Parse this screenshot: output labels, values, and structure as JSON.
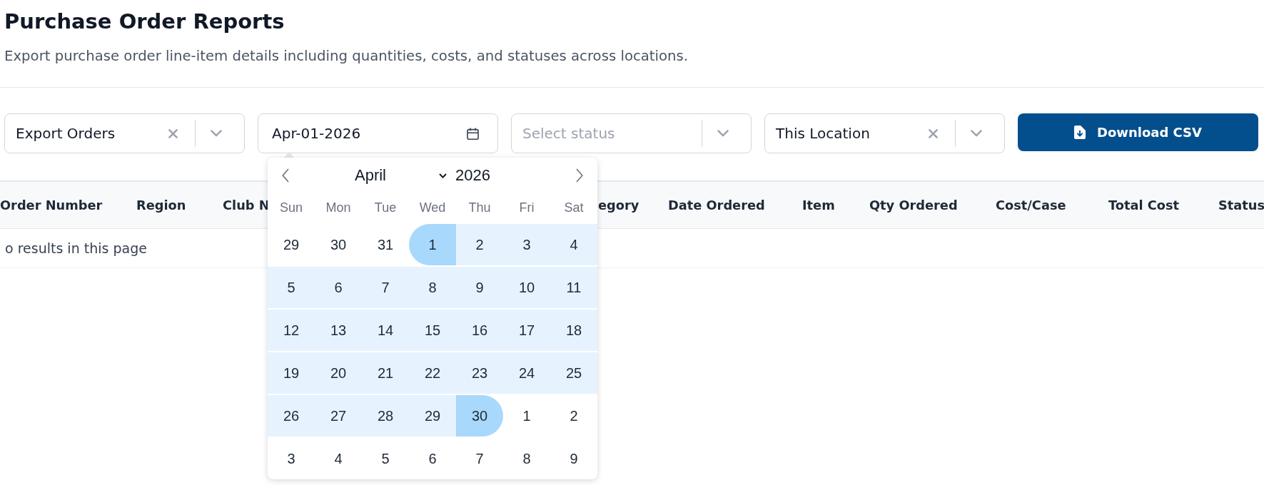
{
  "page": {
    "title": "Purchase Order Reports",
    "subtitle": "Export purchase order line-item details including quantities, costs, and statuses across locations."
  },
  "filters": [
    {
      "kind": "select",
      "value": "Export Orders",
      "clearable": true
    },
    {
      "kind": "date",
      "value": "Apr-01-2026"
    },
    {
      "kind": "select",
      "placeholder": "Select status",
      "clearable": false
    },
    {
      "kind": "select",
      "value": "This Location",
      "clearable": true
    }
  ],
  "download_button": {
    "label": "Download CSV"
  },
  "date_picker": {
    "month": "April",
    "year": "2026",
    "weekdays": [
      "Sun",
      "Mon",
      "Tue",
      "Wed",
      "Thu",
      "Fri",
      "Sat"
    ],
    "weeks": [
      {
        "days": [
          {
            "label": "29",
            "in_range": false,
            "range_start": false,
            "range_end": false
          },
          {
            "label": "30",
            "in_range": false,
            "range_start": false,
            "range_end": false
          },
          {
            "label": "31",
            "in_range": false,
            "range_start": false,
            "range_end": false
          },
          {
            "label": "1",
            "in_range": true,
            "range_start": true,
            "range_end": false
          },
          {
            "label": "2",
            "in_range": true,
            "range_start": false,
            "range_end": false
          },
          {
            "label": "3",
            "in_range": true,
            "range_start": false,
            "range_end": false
          },
          {
            "label": "4",
            "in_range": true,
            "range_start": false,
            "range_end": false
          }
        ]
      },
      {
        "days": [
          {
            "label": "5",
            "in_range": true,
            "range_start": false,
            "range_end": false
          },
          {
            "label": "6",
            "in_range": true,
            "range_start": false,
            "range_end": false
          },
          {
            "label": "7",
            "in_range": true,
            "range_start": false,
            "range_end": false
          },
          {
            "label": "8",
            "in_range": true,
            "range_start": false,
            "range_end": false
          },
          {
            "label": "9",
            "in_range": true,
            "range_start": false,
            "range_end": false
          },
          {
            "label": "10",
            "in_range": true,
            "range_start": false,
            "range_end": false
          },
          {
            "label": "11",
            "in_range": true,
            "range_start": false,
            "range_end": false
          }
        ]
      },
      {
        "days": [
          {
            "label": "12",
            "in_range": true,
            "range_start": false,
            "range_end": false
          },
          {
            "label": "13",
            "in_range": true,
            "range_start": false,
            "range_end": false
          },
          {
            "label": "14",
            "in_range": true,
            "range_start": false,
            "range_end": false
          },
          {
            "label": "15",
            "in_range": true,
            "range_start": false,
            "range_end": false
          },
          {
            "label": "16",
            "in_range": true,
            "range_start": false,
            "range_end": false
          },
          {
            "label": "17",
            "in_range": true,
            "range_start": false,
            "range_end": false
          },
          {
            "label": "18",
            "in_range": true,
            "range_start": false,
            "range_end": false
          }
        ]
      },
      {
        "days": [
          {
            "label": "19",
            "in_range": true,
            "range_start": false,
            "range_end": false
          },
          {
            "label": "20",
            "in_range": true,
            "range_start": false,
            "range_end": false
          },
          {
            "label": "21",
            "in_range": true,
            "range_start": false,
            "range_end": false
          },
          {
            "label": "22",
            "in_range": true,
            "range_start": false,
            "range_end": false
          },
          {
            "label": "23",
            "in_range": true,
            "range_start": false,
            "range_end": false
          },
          {
            "label": "24",
            "in_range": true,
            "range_start": false,
            "range_end": false
          },
          {
            "label": "25",
            "in_range": true,
            "range_start": false,
            "range_end": false
          }
        ]
      },
      {
        "days": [
          {
            "label": "26",
            "in_range": true,
            "range_start": false,
            "range_end": false
          },
          {
            "label": "27",
            "in_range": true,
            "range_start": false,
            "range_end": false
          },
          {
            "label": "28",
            "in_range": true,
            "range_start": false,
            "range_end": false
          },
          {
            "label": "29",
            "in_range": true,
            "range_start": false,
            "range_end": false
          },
          {
            "label": "30",
            "in_range": true,
            "range_start": false,
            "range_end": true
          },
          {
            "label": "1",
            "in_range": false,
            "range_start": false,
            "range_end": false
          },
          {
            "label": "2",
            "in_range": false,
            "range_start": false,
            "range_end": false
          }
        ]
      },
      {
        "days": [
          {
            "label": "3",
            "in_range": false,
            "range_start": false,
            "range_end": false
          },
          {
            "label": "4",
            "in_range": false,
            "range_start": false,
            "range_end": false
          },
          {
            "label": "5",
            "in_range": false,
            "range_start": false,
            "range_end": false
          },
          {
            "label": "6",
            "in_range": false,
            "range_start": false,
            "range_end": false
          },
          {
            "label": "7",
            "in_range": false,
            "range_start": false,
            "range_end": false
          },
          {
            "label": "8",
            "in_range": false,
            "range_start": false,
            "range_end": false
          },
          {
            "label": "9",
            "in_range": false,
            "range_start": false,
            "range_end": false
          }
        ]
      }
    ]
  },
  "table": {
    "columns": [
      "Order Number",
      "Region",
      "Club N",
      "egory",
      "Date Ordered",
      "Item",
      "Qty Ordered",
      "Cost/Case",
      "Total Cost",
      "Status"
    ],
    "empty_message": "o results in this page"
  }
}
